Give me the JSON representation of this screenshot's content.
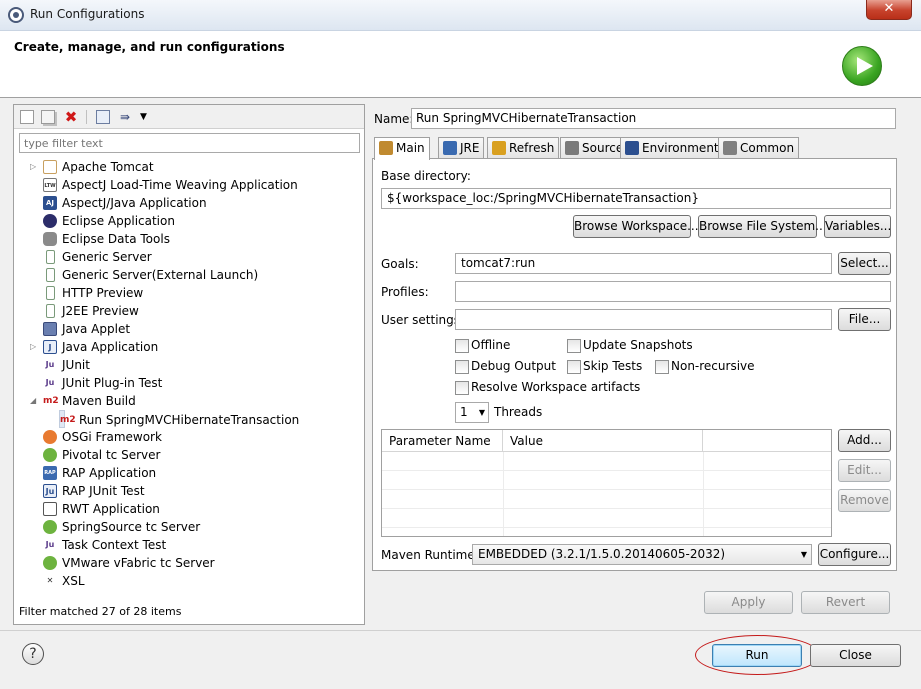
{
  "window": {
    "title": "Run Configurations",
    "close_glyph": "✕"
  },
  "header": {
    "title": "Create, manage, and run configurations"
  },
  "left": {
    "filter_placeholder": "type filter text",
    "tree": [
      {
        "label": "Apache Tomcat",
        "icon": "tomcat-icon",
        "expander": "▷",
        "child": false
      },
      {
        "label": "AspectJ Load-Time Weaving Application",
        "icon": "ltw-icon",
        "badge": "LTW",
        "child": false
      },
      {
        "label": "AspectJ/Java Application",
        "icon": "aj-icon",
        "badge": "AJ",
        "child": false
      },
      {
        "label": "Eclipse Application",
        "icon": "eclipse-icon",
        "child": false
      },
      {
        "label": "Eclipse Data Tools",
        "icon": "database-icon",
        "child": false
      },
      {
        "label": "Generic Server",
        "icon": "server-icon",
        "child": false
      },
      {
        "label": "Generic Server(External Launch)",
        "icon": "server-icon",
        "child": false
      },
      {
        "label": "HTTP Preview",
        "icon": "server-icon",
        "child": false
      },
      {
        "label": "J2EE Preview",
        "icon": "server-icon",
        "child": false
      },
      {
        "label": "Java Applet",
        "icon": "applet-icon",
        "child": false
      },
      {
        "label": "Java Application",
        "icon": "java-app-icon",
        "badge": "J",
        "expander": "▷",
        "child": false
      },
      {
        "label": "JUnit",
        "icon": "junit-icon",
        "badge": "Ju",
        "child": false
      },
      {
        "label": "JUnit Plug-in Test",
        "icon": "junit-plugin-icon",
        "badge": "Ju",
        "child": false
      },
      {
        "label": "Maven Build",
        "icon": "maven-icon",
        "badge": "m2",
        "expander": "◢",
        "child": false
      },
      {
        "label": "Run SpringMVCHibernateTransaction",
        "icon": "maven-icon",
        "badge": "m2",
        "child": true,
        "selected": true
      },
      {
        "label": "OSGi Framework",
        "icon": "osgi-icon",
        "child": false
      },
      {
        "label": "Pivotal tc Server",
        "icon": "spring-icon",
        "child": false
      },
      {
        "label": "RAP Application",
        "icon": "rap-icon",
        "badge": "RAP",
        "child": false
      },
      {
        "label": "RAP JUnit Test",
        "icon": "rap-junit-icon",
        "badge": "Ju",
        "child": false
      },
      {
        "label": "RWT Application",
        "icon": "rwt-icon",
        "child": false
      },
      {
        "label": "SpringSource tc Server",
        "icon": "spring-icon",
        "child": false
      },
      {
        "label": "Task Context Test",
        "icon": "task-icon",
        "badge": "Ju",
        "child": false
      },
      {
        "label": "VMware vFabric tc Server",
        "icon": "spring-icon",
        "child": false
      },
      {
        "label": "XSL",
        "icon": "xsl-icon",
        "badge": "✕",
        "child": false
      }
    ],
    "status": "Filter matched 27 of 28 items"
  },
  "right": {
    "name_label": "Name:",
    "name_value": "Run SpringMVCHibernateTransaction",
    "tabs": [
      {
        "label": "Main",
        "icon": "main-tab-icon"
      },
      {
        "label": "JRE",
        "icon": "jre-tab-icon"
      },
      {
        "label": "Refresh",
        "icon": "refresh-tab-icon"
      },
      {
        "label": "Source",
        "icon": "source-tab-icon"
      },
      {
        "label": "Environment",
        "icon": "environment-tab-icon"
      },
      {
        "label": "Common",
        "icon": "common-tab-icon"
      }
    ],
    "base_dir_label": "Base directory:",
    "base_dir_value": "${workspace_loc:/SpringMVCHibernateTransaction}",
    "browse_workspace": "Browse Workspace...",
    "browse_fs": "Browse File System...",
    "variables": "Variables...",
    "goals_label": "Goals:",
    "goals_value": "tomcat7:run",
    "select_btn": "Select...",
    "profiles_label": "Profiles:",
    "profiles_value": "",
    "user_settings_label": "User settings:",
    "user_settings_value": "",
    "file_btn": "File...",
    "checkboxes": {
      "offline": "Offline",
      "update_snapshots": "Update Snapshots",
      "debug_output": "Debug Output",
      "skip_tests": "Skip Tests",
      "non_recursive": "Non-recursive",
      "resolve_workspace": "Resolve Workspace artifacts"
    },
    "threads_value": "1",
    "threads_label": "Threads",
    "table": {
      "columns": [
        "Parameter Name",
        "Value",
        ""
      ]
    },
    "add_btn": "Add...",
    "edit_btn": "Edit...",
    "remove_btn": "Remove",
    "runtime_label": "Maven Runtime:",
    "runtime_value": "EMBEDDED (3.2.1/1.5.0.20140605-2032)",
    "configure_btn": "Configure...",
    "apply_btn": "Apply",
    "revert_btn": "Revert"
  },
  "footer": {
    "help": "?",
    "run": "Run",
    "close": "Close"
  }
}
